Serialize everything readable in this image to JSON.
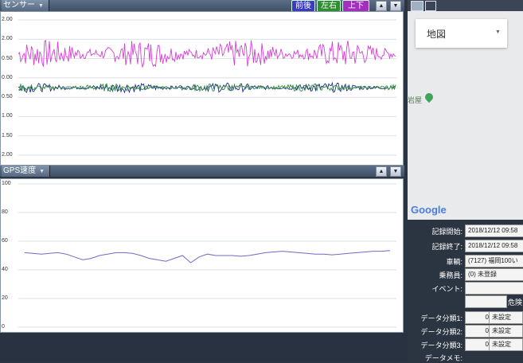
{
  "sensor_panel": {
    "title": "センサー",
    "buttons": [
      {
        "label": "前後",
        "color": "#3c3dbd"
      },
      {
        "label": "左右",
        "color": "#2f8f2f"
      },
      {
        "label": "上下",
        "color": "#a32fbf"
      }
    ]
  },
  "gps_panel": {
    "title": "GPS速度"
  },
  "map": {
    "type_label": "地図",
    "place_label": "岩屋",
    "google_label": "Google"
  },
  "info": {
    "start_label": "記録開始:",
    "start_value": "2018/12/12 09:58",
    "end_label": "記録終了:",
    "end_value": "2018/12/12 09:58",
    "vehicle_label": "車輌:",
    "vehicle_value": "(7127) 福岡100い",
    "crew_label": "乗務員:",
    "crew_value": "(0) 未登録",
    "event_label": "イベント:",
    "danger_label": "危険",
    "cat1_label": "データ分類1:",
    "cat1_num": "0",
    "cat1_value": "未設定",
    "cat2_label": "データ分類2:",
    "cat2_num": "0",
    "cat2_value": "未設定",
    "cat3_label": "データ分類3:",
    "cat3_num": "0",
    "cat3_value": "未設定",
    "memo_label": "データメモ:"
  },
  "colors": {
    "accent": "#2b3441",
    "magenta": "#d63fd6",
    "navy": "#1f2d8a",
    "green": "#2e8b3a",
    "gps_line": "#6c6cc8"
  },
  "chart_data": [
    {
      "type": "line",
      "title": "センサー",
      "ytick_labels": [
        "2.00",
        "2.00",
        "0.50",
        "0.00",
        "0.50",
        "1.00",
        "1.50",
        "2.00"
      ],
      "ylim": [
        -2.0,
        2.0
      ],
      "grid": true,
      "series": [
        {
          "name": "上下",
          "mean": 1.0,
          "amplitude": 0.35,
          "color": "#d63fd6"
        },
        {
          "name": "前後",
          "mean": 0.0,
          "amplitude": 0.12,
          "color": "#1f2d8a"
        },
        {
          "name": "左右",
          "mean": 0.0,
          "amplitude": 0.1,
          "color": "#2e8b3a"
        }
      ]
    },
    {
      "type": "line",
      "title": "GPS速度",
      "ytick_labels": [
        "100",
        "80",
        "60",
        "40",
        "20",
        "0"
      ],
      "ylim": [
        0,
        100
      ],
      "grid": true,
      "series": [
        {
          "values": [
            52,
            51.5,
            51,
            51.5,
            52,
            51,
            49,
            47,
            48,
            50,
            51,
            52,
            52,
            51.5,
            50,
            48,
            47,
            46,
            48,
            50,
            45,
            49,
            51,
            50,
            50,
            50,
            49.5,
            50,
            51,
            52,
            52.5,
            53,
            52.5,
            52,
            51.5,
            51,
            51,
            50.5,
            51,
            51.5,
            52,
            52.5,
            53,
            53,
            53.5
          ],
          "color": "#6c6cc8"
        }
      ]
    }
  ]
}
